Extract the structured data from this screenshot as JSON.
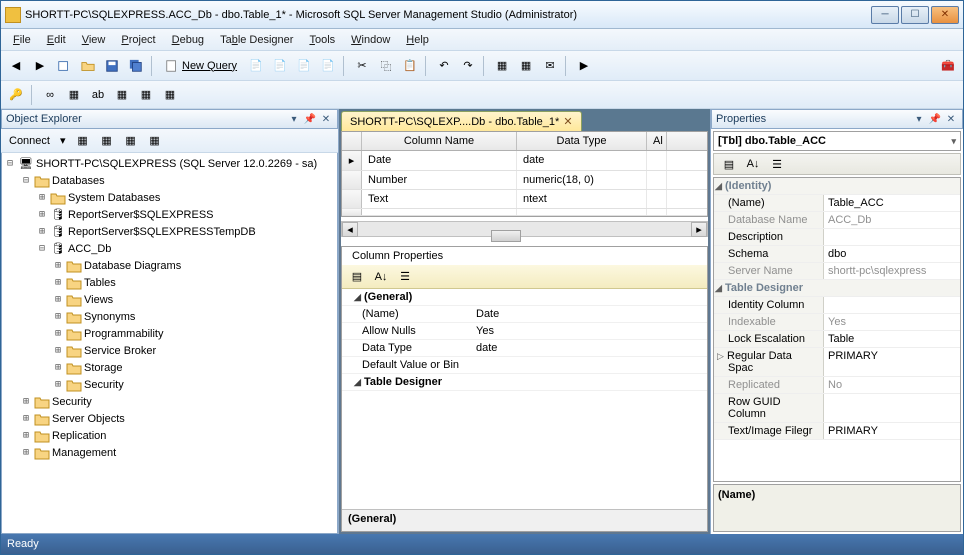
{
  "title": "SHORTT-PC\\SQLEXPRESS.ACC_Db - dbo.Table_1* - Microsoft SQL Server Management Studio (Administrator)",
  "menu": [
    "File",
    "Edit",
    "View",
    "Project",
    "Debug",
    "Table Designer",
    "Tools",
    "Window",
    "Help"
  ],
  "newQueryLabel": "New Query",
  "objectExplorer": {
    "title": "Object Explorer",
    "connectLabel": "Connect",
    "root": "SHORTT-PC\\SQLEXPRESS (SQL Server 12.0.2269 - sa)",
    "databasesLabel": "Databases",
    "sysDb": "System Databases",
    "rs1": "ReportServer$SQLEXPRESS",
    "rs2": "ReportServer$SQLEXPRESSTempDB",
    "accdb": "ACC_Db",
    "accChildren": [
      "Database Diagrams",
      "Tables",
      "Views",
      "Synonyms",
      "Programmability",
      "Service Broker",
      "Storage",
      "Security"
    ],
    "topChildren": [
      "Security",
      "Server Objects",
      "Replication",
      "Management"
    ]
  },
  "tab": "SHORTT-PC\\SQLEXP....Db - dbo.Table_1*",
  "gridHeaders": {
    "name": "Column Name",
    "type": "Data Type",
    "nulls": "Al"
  },
  "columns": [
    {
      "name": "Date",
      "type": "date"
    },
    {
      "name": "Number",
      "type": "numeric(18, 0)"
    },
    {
      "name": "Text",
      "type": "ntext"
    }
  ],
  "columnPropsTitle": "Column Properties",
  "colProps": {
    "catGeneral": "(General)",
    "name_k": "(Name)",
    "name_v": "Date",
    "allow_k": "Allow Nulls",
    "allow_v": "Yes",
    "dtype_k": "Data Type",
    "dtype_v": "date",
    "def_k": "Default Value or Bin",
    "catTD": "Table Designer",
    "footer": "(General)"
  },
  "propertiesTitle": "Properties",
  "propObj": "[Tbl] dbo.Table_ACC",
  "props": {
    "catIdentity": "(Identity)",
    "name_k": "(Name)",
    "name_v": "Table_ACC",
    "dbn_k": "Database Name",
    "dbn_v": "ACC_Db",
    "desc_k": "Description",
    "desc_v": "",
    "sch_k": "Schema",
    "sch_v": "dbo",
    "srv_k": "Server Name",
    "srv_v": "shortt-pc\\sqlexpress",
    "catTD": "Table Designer",
    "idc_k": "Identity Column",
    "idc_v": "",
    "idx_k": "Indexable",
    "idx_v": "Yes",
    "lock_k": "Lock Escalation",
    "lock_v": "Table",
    "rds_k": "Regular Data Spac",
    "rds_v": "PRIMARY",
    "rep_k": "Replicated",
    "rep_v": "No",
    "rgc_k": "Row GUID Column",
    "rgc_v": "",
    "tif_k": "Text/Image Filegr",
    "tif_v": "PRIMARY"
  },
  "propDesc": "(Name)",
  "status": "Ready"
}
